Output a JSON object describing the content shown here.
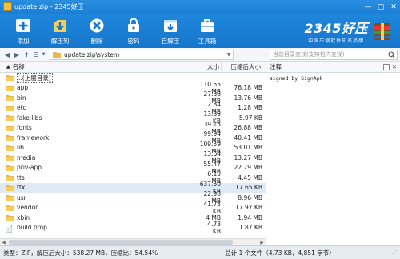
{
  "window": {
    "title": "update.zip - 2345好压",
    "min": "—",
    "max": "▢",
    "close": "✕"
  },
  "toolbar": {
    "items": [
      {
        "label": "添加",
        "icon": "add-icon"
      },
      {
        "label": "解压到",
        "icon": "extract-icon"
      },
      {
        "label": "删除",
        "icon": "delete-icon"
      },
      {
        "label": "密码",
        "icon": "password-icon"
      },
      {
        "label": "自解压",
        "icon": "self-extract-icon"
      },
      {
        "label": "工具箱",
        "icon": "toolbox-icon"
      }
    ],
    "brand_logo": "2345好压",
    "brand_slogan": "中国压缩软件知名品牌"
  },
  "address": {
    "path": "update.zip\\system",
    "search_placeholder": "当前目录查找(支持包内查找)"
  },
  "columns": {
    "name": "名称",
    "size": "大小",
    "packed": "压缩后大小",
    "notes": "注释"
  },
  "files": [
    {
      "name": "..(上层目录)",
      "size": "",
      "packed": "",
      "type": "parent"
    },
    {
      "name": "app",
      "size": "110.55 MB",
      "packed": "76.18 MB",
      "type": "folder"
    },
    {
      "name": "bin",
      "size": "27.38 MB",
      "packed": "13.76 MB",
      "type": "folder"
    },
    {
      "name": "etc",
      "size": "2.84 MB",
      "packed": "1.28 MB",
      "type": "folder"
    },
    {
      "name": "fake-libs",
      "size": "13.35 KB",
      "packed": "5.97 KB",
      "type": "folder"
    },
    {
      "name": "fonts",
      "size": "39.15 MB",
      "packed": "26.88 MB",
      "type": "folder"
    },
    {
      "name": "framework",
      "size": "99.94 MB",
      "packed": "40.41 MB",
      "type": "folder"
    },
    {
      "name": "lib",
      "size": "109.59 MB",
      "packed": "53.01 MB",
      "type": "folder"
    },
    {
      "name": "media",
      "size": "13.64 MB",
      "packed": "13.27 MB",
      "type": "folder"
    },
    {
      "name": "priv-app",
      "size": "55.47 MB",
      "packed": "22.79 MB",
      "type": "folder"
    },
    {
      "name": "tts",
      "size": "6.15 MB",
      "packed": "4.45 MB",
      "type": "folder"
    },
    {
      "name": "ttx",
      "size": "637.50 KB",
      "packed": "17.65 KB",
      "type": "folder"
    },
    {
      "name": "usr",
      "size": "22.98 MB",
      "packed": "8.96 MB",
      "type": "folder"
    },
    {
      "name": "vendor",
      "size": "41.75 KB",
      "packed": "17.97 KB",
      "type": "folder"
    },
    {
      "name": "xbin",
      "size": "4 MB",
      "packed": "1.94 MB",
      "type": "folder"
    },
    {
      "name": "build.prop",
      "size": "4.73 KB",
      "packed": "1.87 KB",
      "type": "file"
    }
  ],
  "selected_row": "ttx",
  "notes_text": "signed by SignApk",
  "status": {
    "left": "类型：ZIP，解压后大小：538.27 MB，压缩比：54.54%",
    "right": "总计 1 个文件（4.73 KB，4,851 字节）"
  },
  "colors": {
    "titlebar": "#1b7fd6",
    "toolbar": "#1676cc",
    "folder": "#e8b84a",
    "selected": "#dfeaf7"
  }
}
